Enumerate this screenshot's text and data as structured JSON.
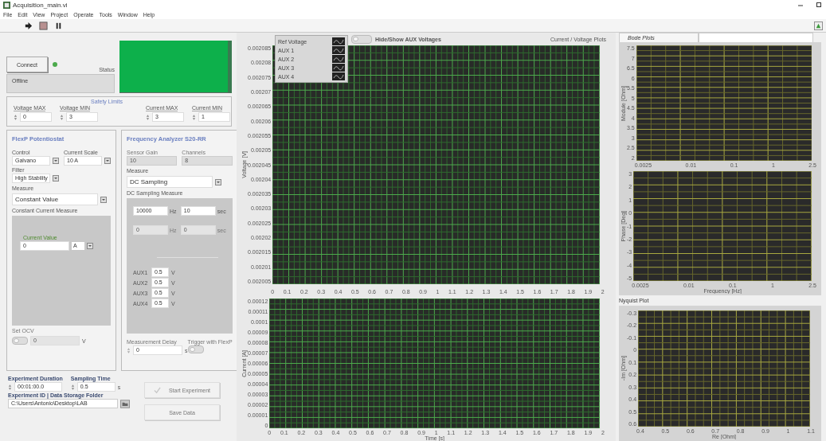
{
  "window": {
    "title": "Acquisition_main.vi"
  },
  "menu": [
    "File",
    "Edit",
    "View",
    "Project",
    "Operate",
    "Tools",
    "Window",
    "Help"
  ],
  "connection": {
    "button": "Connect",
    "connected": true,
    "status_label": "Status",
    "status": "Offline"
  },
  "safety_limits": {
    "title": "Safety Limits",
    "fields": [
      {
        "label": "Voltage MAX",
        "value": "0"
      },
      {
        "label": "Voltage MIN",
        "value": "3"
      },
      {
        "label": "Current MAX",
        "value": "3"
      },
      {
        "label": "Current MIN",
        "value": "1"
      }
    ]
  },
  "potentiostat": {
    "title": "FlexP Potentiostat",
    "selects": [
      {
        "label": "Control",
        "value": "Galvano"
      },
      {
        "label": "Current Scale",
        "value": "10 A"
      },
      {
        "label": "Filter",
        "value": "High Stability"
      }
    ],
    "measure": {
      "label": "Measure",
      "value": "Constant Value"
    },
    "sub_title": "Constant Current Measure",
    "current_value": {
      "label": "Current Value",
      "value": "0",
      "unit": "A"
    },
    "ocv": {
      "label": "Set OCV",
      "on": false,
      "value": "0",
      "unit": "V"
    }
  },
  "analyzer": {
    "title": "Frequency Analyzer S20-RR",
    "readouts": [
      {
        "label": "Sensor Gain",
        "value": "10"
      },
      {
        "label": "Channels",
        "value": "8"
      }
    ],
    "measure": {
      "label": "Measure",
      "value": "DC Sampling"
    },
    "sub_title": "DC Sampling Measure",
    "params": [
      {
        "value": "10000",
        "unit": "Hz",
        "disabled": false
      },
      {
        "value": "10",
        "unit": "sec",
        "disabled": false
      },
      {
        "value": "0",
        "unit": "Hz",
        "disabled": true
      },
      {
        "value": "0",
        "unit": "sec",
        "disabled": true
      }
    ],
    "aux": [
      {
        "label": "AUX1",
        "value": "0.5",
        "unit": "V"
      },
      {
        "label": "AUX2",
        "value": "0.5",
        "unit": "V"
      },
      {
        "label": "AUX3",
        "value": "0.5",
        "unit": "V"
      },
      {
        "label": "AUX4",
        "value": "0.5",
        "unit": "V"
      }
    ],
    "delay": {
      "label": "Measurement Delay",
      "value": "0",
      "unit": "s"
    },
    "trigger": {
      "label": "Trigger with FlexP",
      "on": false
    }
  },
  "experiment": {
    "duration": {
      "label": "Experiment Duration",
      "value": "00:01:00.0"
    },
    "sampling": {
      "label": "Sampling Time",
      "value": "0.5",
      "unit": "s"
    },
    "folder": {
      "label": "Experiment ID | Data Storage Folder",
      "value": "C:\\Users\\Antonio\\Desktop\\LAB"
    },
    "start_button": {
      "label": "Start Experiment",
      "disabled": true
    },
    "save_button": {
      "label": "Save Data",
      "disabled": true
    }
  },
  "plots": {
    "aux_toggle": {
      "label": "Hide/Show AUX Voltages",
      "on": false
    },
    "title": "Current / Voltage Plots",
    "legend": [
      "Ref Voltage",
      "AUX 1",
      "AUX 2",
      "AUX 3",
      "AUX 4"
    ],
    "charts": [
      {
        "ylabel": "Voltage [V]",
        "yticks": [
          "0.002085",
          "0.00208",
          "0.002075",
          "0.00207",
          "0.002065",
          "0.00206",
          "0.002055",
          "0.00205",
          "0.002045",
          "0.00204",
          "0.002035",
          "0.00203",
          "0.002025",
          "0.00202",
          "0.002015",
          "0.00201",
          "0.002005"
        ],
        "xticks": [
          "0",
          "0.1",
          "0.2",
          "0.3",
          "0.4",
          "0.5",
          "0.6",
          "0.7",
          "0.8",
          "0.9",
          "1",
          "1.1",
          "1.2",
          "1.3",
          "1.4",
          "1.5",
          "1.6",
          "1.7",
          "1.8",
          "1.9",
          "2"
        ]
      },
      {
        "ylabel": "Current [A]",
        "yticks": [
          "0.00012",
          "0.00011",
          "0.0001",
          "0.00009",
          "0.00008",
          "0.00007",
          "0.00006",
          "0.00005",
          "0.00004",
          "0.00003",
          "0.00002",
          "0.00001",
          "0"
        ],
        "xticks": [
          "0",
          "0.1",
          "0.2",
          "0.3",
          "0.4",
          "0.5",
          "0.6",
          "0.7",
          "0.8",
          "0.9",
          "1",
          "1.1",
          "1.2",
          "1.3",
          "1.4",
          "1.5",
          "1.6",
          "1.7",
          "1.8",
          "1.9",
          "2"
        ],
        "xlabel": "Time [s]"
      }
    ]
  },
  "tabs": [
    {
      "label": "Bode Plots",
      "selected": true
    },
    {
      "selected": false
    }
  ],
  "bode": [
    {
      "ylabel": "Module [Ohm]",
      "yticks": [
        "7.5",
        "7",
        "6.5",
        "6",
        "5.5",
        "5",
        "4.5",
        "4",
        "3.5",
        "3",
        "2.5",
        "2"
      ],
      "xticks": [
        "0.0025",
        "0.01",
        "0.1",
        "1",
        "2.5"
      ]
    },
    {
      "ylabel": "Phase [Deg]",
      "yticks": [
        "3",
        "2",
        "1",
        "0",
        "-1",
        "-2",
        "-3",
        "-4",
        "-5"
      ],
      "xticks": [
        "0.0025",
        "0.01",
        "0.1",
        "1",
        "2.5"
      ],
      "xlabel": "Frequency [Hz]"
    }
  ],
  "nyquist": {
    "title": "Nyquist Plot",
    "charts": [
      {
        "ylabel": "-Im [Ohm]",
        "yticks": [
          "-0.3",
          "-0.2",
          "-0.1",
          "0",
          "0.1",
          "0.2",
          "0.3",
          "0.4",
          "0.5",
          "0.6"
        ],
        "xticks": [
          "0.4",
          "0.5",
          "0.6",
          "0.7",
          "0.8",
          "0.9",
          "1",
          "1.1"
        ],
        "xlabel": "Re [Ohm]"
      }
    ]
  }
}
